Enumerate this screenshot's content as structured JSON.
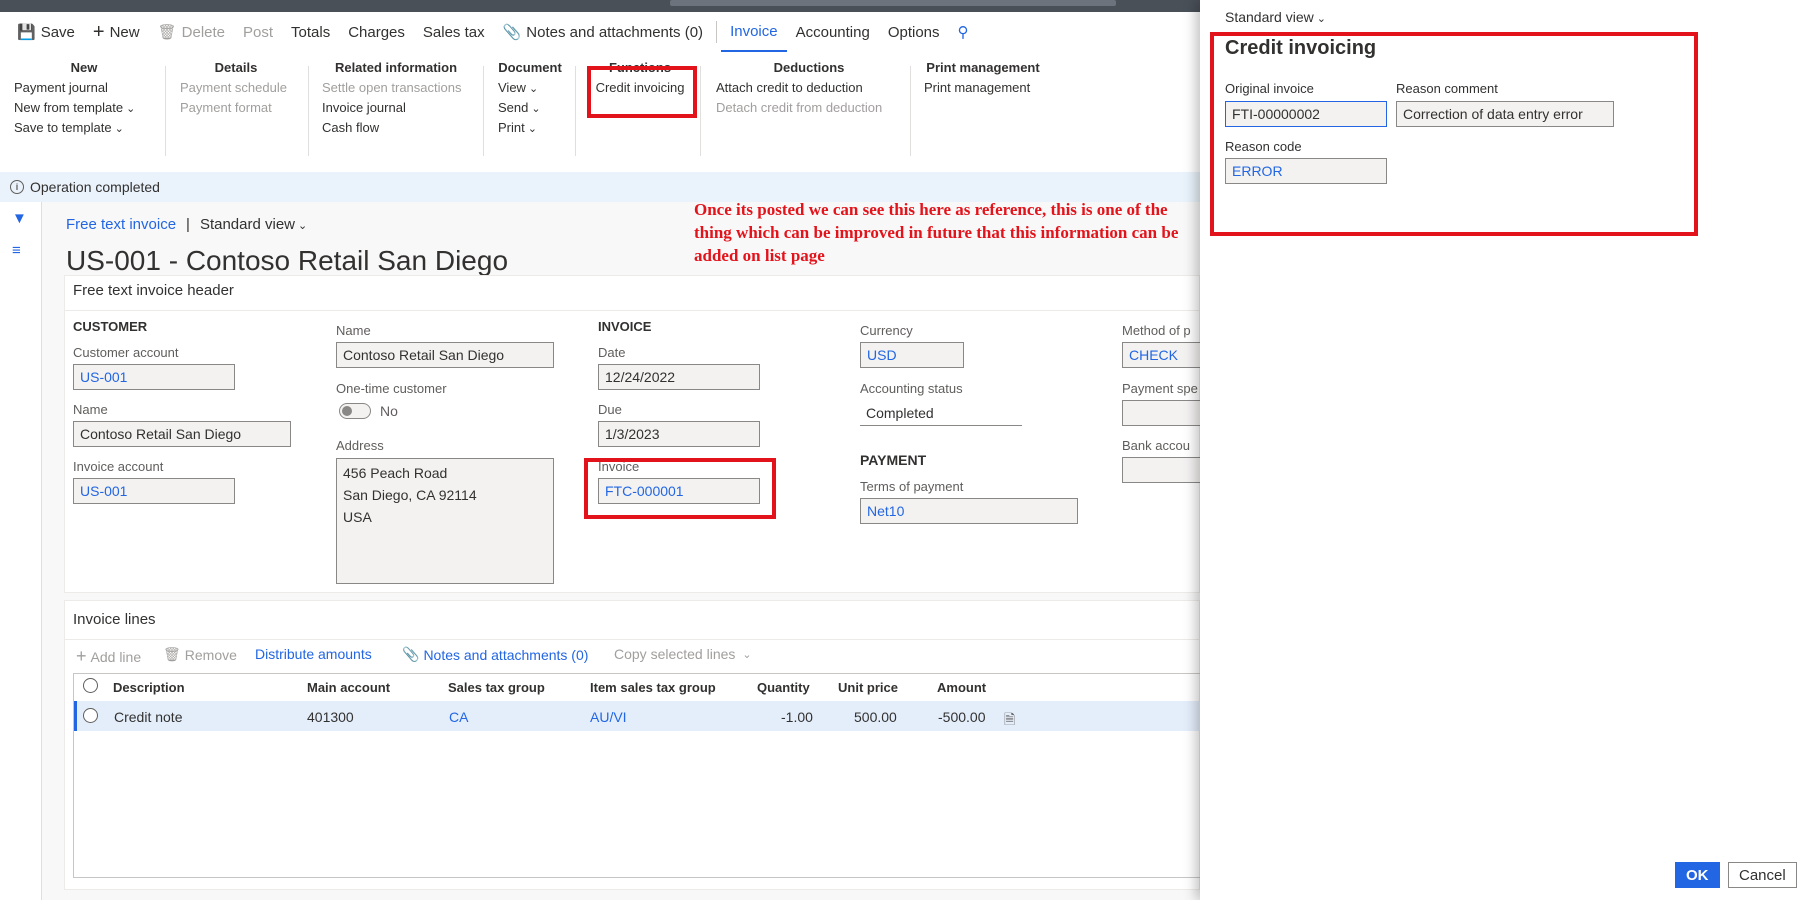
{
  "actionbar": {
    "save": "Save",
    "new": "New",
    "delete": "Delete",
    "post": "Post",
    "totals": "Totals",
    "charges": "Charges",
    "sales_tax": "Sales tax",
    "notes": "Notes and attachments (0)",
    "tab_invoice": "Invoice",
    "tab_accounting": "Accounting",
    "tab_options": "Options"
  },
  "ribbon": {
    "new": {
      "title": "New",
      "items": [
        "Payment journal",
        "New from template",
        "Save to template"
      ]
    },
    "details": {
      "title": "Details",
      "items": [
        "Payment schedule",
        "Payment format"
      ]
    },
    "related": {
      "title": "Related information",
      "items": [
        "Settle open transactions",
        "Invoice journal",
        "Cash flow"
      ]
    },
    "document": {
      "title": "Document",
      "items": [
        "View",
        "Send",
        "Print"
      ]
    },
    "functions": {
      "title": "Functions",
      "items": [
        "Credit invoicing"
      ]
    },
    "deductions": {
      "title": "Deductions",
      "items": [
        "Attach credit to deduction",
        "Detach credit from deduction"
      ]
    },
    "print": {
      "title": "Print management",
      "items": [
        "Print management"
      ]
    }
  },
  "message": "Operation completed",
  "breadcrumb": {
    "link": "Free text invoice",
    "sep": "|",
    "view": "Standard view"
  },
  "page_title": "US-001 - Contoso Retail San Diego",
  "annotation": "Once its posted we can see this here as reference, this is one of the thing which can be improved in future that this information can be added on list page",
  "header": {
    "title": "Free text invoice header",
    "customer_section": "CUSTOMER",
    "customer_account_label": "Customer account",
    "customer_account": "US-001",
    "name_label": "Name",
    "name": "Contoso Retail San Diego",
    "invoice_account_label": "Invoice account",
    "invoice_account": "US-001",
    "name2_label": "Name",
    "name2": "Contoso Retail San Diego",
    "onetime_label": "One-time customer",
    "onetime_value": "No",
    "address_label": "Address",
    "address": "456 Peach Road\nSan Diego, CA 92114\nUSA",
    "invoice_section": "INVOICE",
    "date_label": "Date",
    "date": "12/24/2022",
    "due_label": "Due",
    "due": "1/3/2023",
    "invoice_label": "Invoice",
    "invoice": "FTC-000001",
    "currency_label": "Currency",
    "currency": "USD",
    "acct_status_label": "Accounting status",
    "acct_status": "Completed",
    "payment_section": "PAYMENT",
    "terms_label": "Terms of payment",
    "terms": "Net10",
    "method_label": "Method of p",
    "method": "CHECK",
    "payment_spec_label": "Payment spe",
    "bank_label": "Bank accou"
  },
  "lines": {
    "title": "Invoice lines",
    "add_line": "Add line",
    "remove": "Remove",
    "distribute": "Distribute amounts",
    "notes": "Notes and attachments (0)",
    "copy": "Copy selected lines",
    "columns": [
      "Description",
      "Main account",
      "Sales tax group",
      "Item sales tax group",
      "Quantity",
      "Unit price",
      "Amount"
    ],
    "rows": [
      {
        "description": "Credit note",
        "main_account": "401300",
        "sales_tax_group": "CA",
        "item_sales_tax_group": "AU/VI",
        "quantity": "-1.00",
        "unit_price": "500.00",
        "amount": "-500.00"
      }
    ]
  },
  "dialog": {
    "view": "Standard view",
    "title": "Credit invoicing",
    "original_invoice_label": "Original invoice",
    "original_invoice": "FTI-00000002",
    "reason_comment_label": "Reason comment",
    "reason_comment": "Correction of data entry error",
    "reason_code_label": "Reason code",
    "reason_code": "ERROR",
    "ok": "OK",
    "cancel": "Cancel"
  },
  "colors": {
    "accent": "#2266e3",
    "annotation_red": "#e3131b",
    "message_bg": "#eaf3fb"
  }
}
